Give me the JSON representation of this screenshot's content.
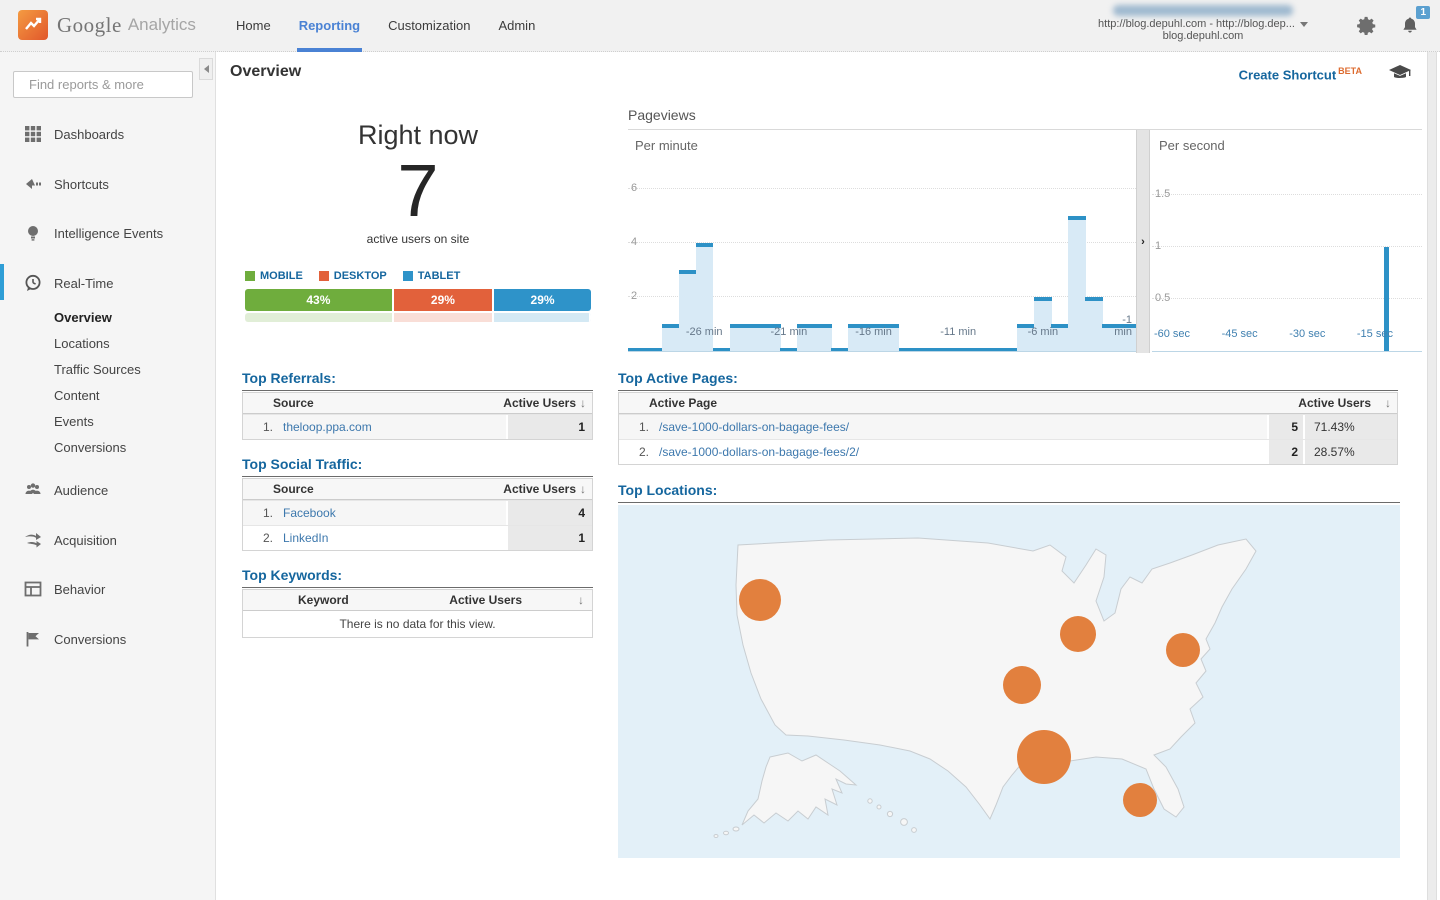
{
  "header": {
    "logo": {
      "google": "Google",
      "analytics": "Analytics"
    },
    "nav": [
      {
        "label": "Home",
        "active": false
      },
      {
        "label": "Reporting",
        "active": true
      },
      {
        "label": "Customization",
        "active": false
      },
      {
        "label": "Admin",
        "active": false
      }
    ],
    "account": {
      "property_line1": "http://blog.depuhl.com - http://blog.dep...",
      "property_line2": "blog.depuhl.com",
      "notification_count": "1"
    }
  },
  "sidebar": {
    "search_placeholder": "Find reports & more",
    "items": [
      {
        "label": "Dashboards"
      },
      {
        "label": "Shortcuts"
      },
      {
        "label": "Intelligence Events"
      },
      {
        "label": "Real-Time",
        "active": true
      },
      {
        "label": "Audience"
      },
      {
        "label": "Acquisition"
      },
      {
        "label": "Behavior"
      },
      {
        "label": "Conversions"
      }
    ],
    "realtime_children": [
      {
        "label": "Overview",
        "active": true
      },
      {
        "label": "Locations"
      },
      {
        "label": "Traffic Sources"
      },
      {
        "label": "Content"
      },
      {
        "label": "Events"
      },
      {
        "label": "Conversions"
      }
    ]
  },
  "page": {
    "title": "Overview",
    "create_shortcut": "Create Shortcut",
    "beta_badge": "BETA"
  },
  "right_now": {
    "heading": "Right now",
    "active_users": "7",
    "caption": "active users on site",
    "device_split": [
      {
        "label": "MOBILE",
        "pct": 43,
        "display": "43%",
        "color": "#6fad3d"
      },
      {
        "label": "DESKTOP",
        "pct": 29,
        "display": "29%",
        "color": "#e2613b"
      },
      {
        "label": "TABLET",
        "pct": 28,
        "display": "29%",
        "color": "#2e93c9"
      }
    ]
  },
  "chart_data": [
    {
      "type": "bar",
      "title": "Pageviews",
      "panel_label": "Per minute",
      "x_range_minutes": [
        -30,
        -1
      ],
      "values": [
        0,
        0,
        1,
        3,
        4,
        0,
        1,
        1,
        1,
        0,
        1,
        1,
        0,
        1,
        1,
        1,
        0,
        0,
        0,
        0,
        0,
        0,
        0,
        1,
        2,
        1,
        5,
        2,
        1,
        1
      ],
      "ylim": [
        0,
        8
      ],
      "yticks": [
        2,
        4,
        6
      ],
      "xticks": [
        {
          "slot": 4,
          "label": "-26 min"
        },
        {
          "slot": 9,
          "label": "-21 min"
        },
        {
          "slot": 14,
          "label": "-16 min"
        },
        {
          "slot": 19,
          "label": "-11 min"
        },
        {
          "slot": 24,
          "label": "-6 min"
        },
        {
          "slot": 29,
          "label": "-1 min"
        }
      ],
      "bar_fill": "#d8eaf6",
      "bar_cap": "#2d91c6",
      "grid": true,
      "legend_position": "none"
    },
    {
      "type": "bar",
      "title": "Pageviews",
      "panel_label": "Per second",
      "x_range_seconds": [
        -60,
        0
      ],
      "yticks": [
        0.5,
        1,
        1.5
      ],
      "ylim": [
        0,
        2
      ],
      "xticks": [
        {
          "sec": -60,
          "label": "-60 sec"
        },
        {
          "sec": -45,
          "label": "-45 sec"
        },
        {
          "sec": -30,
          "label": "-30 sec"
        },
        {
          "sec": -15,
          "label": "-15 sec"
        }
      ],
      "bars": [
        {
          "sec": -13,
          "value": 1
        }
      ],
      "bar_color": "#2d91c6",
      "grid": true,
      "legend_position": "none"
    }
  ],
  "referrals": {
    "heading": "Top Referrals:",
    "col_source": "Source",
    "col_users": "Active Users",
    "sort_arrow": "↓",
    "rows": [
      {
        "index": "1.",
        "source": "theloop.ppa.com",
        "users": "1"
      }
    ]
  },
  "social": {
    "heading": "Top Social Traffic:",
    "col_source": "Source",
    "col_users": "Active Users",
    "sort_arrow": "↓",
    "rows": [
      {
        "index": "1.",
        "source": "Facebook",
        "users": "4"
      },
      {
        "index": "2.",
        "source": "LinkedIn",
        "users": "1"
      }
    ]
  },
  "keywords": {
    "heading": "Top Keywords:",
    "col_keyword": "Keyword",
    "col_users": "Active Users",
    "sort_arrow": "↓",
    "empty_message": "There is no data for this view."
  },
  "active_pages": {
    "heading": "Top Active Pages:",
    "col_page": "Active Page",
    "col_users": "Active Users",
    "sort_arrow": "↓",
    "rows": [
      {
        "index": "1.",
        "page": "/save-1000-dollars-on-bagage-fees/",
        "users": "5",
        "pct": "71.43%"
      },
      {
        "index": "2.",
        "page": "/save-1000-dollars-on-bagage-fees/2/",
        "users": "2",
        "pct": "28.57%"
      }
    ]
  },
  "locations": {
    "heading": "Top Locations:",
    "marker_color": "#e2803e",
    "water_color": "#e3f0f8",
    "land_color": "#f6f6f6",
    "markers": [
      {
        "x": 142,
        "y": 95,
        "r": 21
      },
      {
        "x": 460,
        "y": 129,
        "r": 18
      },
      {
        "x": 565,
        "y": 145,
        "r": 17
      },
      {
        "x": 404,
        "y": 180,
        "r": 19
      },
      {
        "x": 426,
        "y": 252,
        "r": 27
      },
      {
        "x": 522,
        "y": 295,
        "r": 17
      }
    ]
  }
}
